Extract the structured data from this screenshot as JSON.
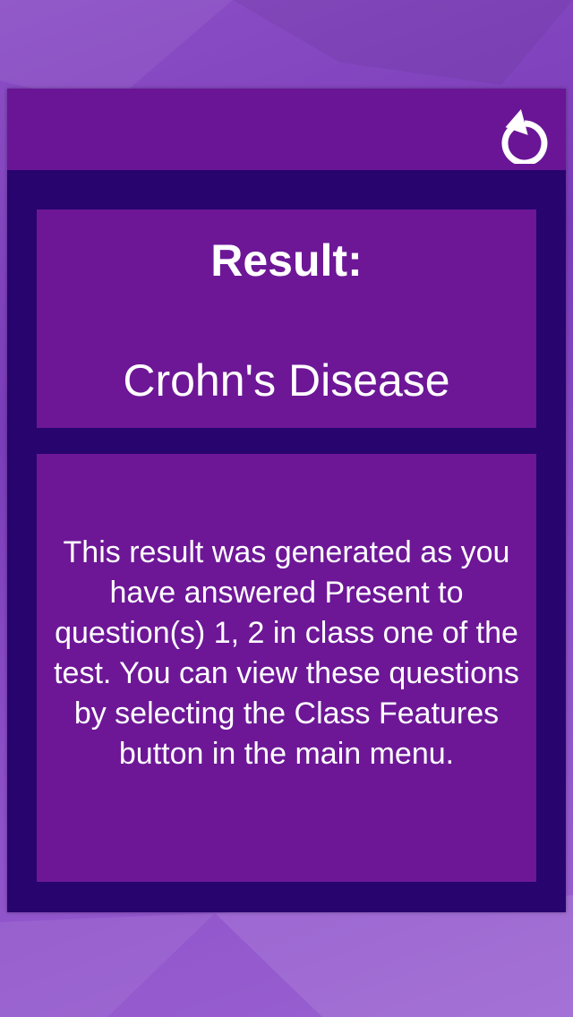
{
  "header": {
    "back_icon": "refresh-back-icon"
  },
  "result": {
    "label": "Result:",
    "value": "Crohn's Disease"
  },
  "explanation": {
    "text": "This result was generated as you have answered Present to question(s) 1, 2 in class one of the test. You can view these questions by selecting the Class Features button in the main menu."
  },
  "colors": {
    "panel_dark": "#27046e",
    "header": "#6a1596",
    "card": "#6d1797",
    "text": "#ffffff"
  }
}
